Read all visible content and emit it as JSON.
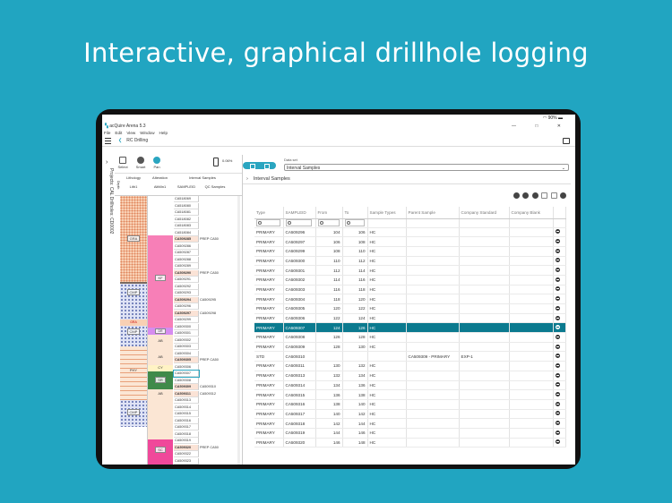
{
  "headline": "Interactive, graphical drillhole logging",
  "status": {
    "battery": "90%"
  },
  "window": {
    "title": "acQuire Arena 5.3",
    "controls": "— □ ✕"
  },
  "menu": [
    "File",
    "Edit",
    "View",
    "Window",
    "Help"
  ],
  "breadcrumb": {
    "back": "❮",
    "title": "RC Drilling"
  },
  "side_path": "Projects: CAL   Drillholes: CD0002",
  "left_toolbar": {
    "tools": [
      "Select",
      "Smart",
      "Pan"
    ],
    "zoom": "0.06%"
  },
  "log_headers": {
    "lithology": "Lithology",
    "alteration": "Alteration",
    "interval_samples": "Interval Samples",
    "depth": "Depth",
    "lith": "Lith1",
    "altmin": "AltMin1",
    "sampleid": "SAMPLEID",
    "qc": "QC Samples"
  },
  "lith_labels": {
    "gra": "GRA",
    "cmp1": "CMP",
    "gra2": "GRA",
    "cmp2": "CMP",
    "phy": "PHY",
    "cmp3": "CMP"
  },
  "alt_labels": {
    "kf": "KF",
    "dr": "DR",
    "ab1": "AB",
    "ab2": "AB",
    "cy": "CY",
    "sr": "SR",
    "ab3": "AB",
    "sc": "SC"
  },
  "log_samples": [
    {
      "id": "CA518069",
      "qc": "",
      "hl": false
    },
    {
      "id": "CA518080",
      "qc": "",
      "hl": false
    },
    {
      "id": "CA518081",
      "qc": "",
      "hl": false
    },
    {
      "id": "CA518082",
      "qc": "",
      "hl": false
    },
    {
      "id": "CA518083",
      "qc": "",
      "hl": false
    },
    {
      "id": "CA518084",
      "qc": "",
      "hl": false
    },
    {
      "id": "CA509285",
      "qc": "PREP CA50",
      "hl": true
    },
    {
      "id": "CA509286",
      "qc": "",
      "hl": false
    },
    {
      "id": "CA509287",
      "qc": "",
      "hl": false
    },
    {
      "id": "CA509288",
      "qc": "",
      "hl": false
    },
    {
      "id": "CA509289",
      "qc": "",
      "hl": false
    },
    {
      "id": "CA509290",
      "qc": "PREP CA50",
      "hl": true
    },
    {
      "id": "CA509291",
      "qc": "",
      "hl": false
    },
    {
      "id": "CA509292",
      "qc": "",
      "hl": false
    },
    {
      "id": "CA509293",
      "qc": "",
      "hl": false
    },
    {
      "id": "CA509294",
      "qc": "CA509295",
      "hl": true
    },
    {
      "id": "CA509296",
      "qc": "",
      "hl": false
    },
    {
      "id": "CA509297",
      "qc": "CA509298",
      "hl": true
    },
    {
      "id": "CA509299",
      "qc": "",
      "hl": false
    },
    {
      "id": "CA509300",
      "qc": "",
      "hl": false
    },
    {
      "id": "CA509301",
      "qc": "",
      "hl": false
    },
    {
      "id": "CA509302",
      "qc": "",
      "hl": false
    },
    {
      "id": "CA509303",
      "qc": "",
      "hl": false
    },
    {
      "id": "CA509304",
      "qc": "",
      "hl": false
    },
    {
      "id": "CA509305",
      "qc": "PREP CA50",
      "hl": true
    },
    {
      "id": "CA509306",
      "qc": "",
      "hl": false
    },
    {
      "id": "CA509307",
      "qc": "",
      "hl": false,
      "sel": true
    },
    {
      "id": "CA509308",
      "qc": "",
      "hl": false
    },
    {
      "id": "CA509309",
      "qc": "CA509310",
      "hl": true
    },
    {
      "id": "CA509311",
      "qc": "CA509312",
      "hl": true
    },
    {
      "id": "CA509313",
      "qc": "",
      "hl": false
    },
    {
      "id": "CA509314",
      "qc": "",
      "hl": false
    },
    {
      "id": "CA509315",
      "qc": "",
      "hl": false
    },
    {
      "id": "CA509316",
      "qc": "",
      "hl": false
    },
    {
      "id": "CA509317",
      "qc": "",
      "hl": false
    },
    {
      "id": "CA509318",
      "qc": "",
      "hl": false
    },
    {
      "id": "CA509319",
      "qc": "",
      "hl": false
    },
    {
      "id": "CA509320",
      "qc": "PREP CA50",
      "hl": true
    },
    {
      "id": "CA509322",
      "qc": "",
      "hl": false
    },
    {
      "id": "CA509323",
      "qc": "",
      "hl": false
    }
  ],
  "dataset": {
    "label": "Data set",
    "value": "Interval Samples"
  },
  "section_title": "Interval Samples",
  "grid": {
    "columns": [
      "Type",
      "SAMPLEID",
      "From",
      "To",
      "Sample Types",
      "Parent Sample",
      "Company Standard",
      "Company Blank"
    ],
    "rows": [
      [
        "PRIMARY",
        "CA509296",
        "104",
        "106",
        "HC",
        "",
        "",
        ""
      ],
      [
        "PRIMARY",
        "CA509297",
        "106",
        "108",
        "HC",
        "",
        "",
        ""
      ],
      [
        "PRIMARY",
        "CA509299",
        "108",
        "110",
        "HC",
        "",
        "",
        ""
      ],
      [
        "PRIMARY",
        "CA509300",
        "110",
        "112",
        "HC",
        "",
        "",
        ""
      ],
      [
        "PRIMARY",
        "CA509301",
        "112",
        "114",
        "HC",
        "",
        "",
        ""
      ],
      [
        "PRIMARY",
        "CA509302",
        "114",
        "116",
        "HC",
        "",
        "",
        ""
      ],
      [
        "PRIMARY",
        "CA509303",
        "116",
        "118",
        "HC",
        "",
        "",
        ""
      ],
      [
        "PRIMARY",
        "CA509304",
        "118",
        "120",
        "HC",
        "",
        "",
        ""
      ],
      [
        "PRIMARY",
        "CA509305",
        "120",
        "122",
        "HC",
        "",
        "",
        ""
      ],
      [
        "PRIMARY",
        "CA509306",
        "122",
        "124",
        "HC",
        "",
        "",
        ""
      ],
      [
        "PRIMARY",
        "CA509307",
        "124",
        "126",
        "HC",
        "",
        "",
        ""
      ],
      [
        "PRIMARY",
        "CA509308",
        "126",
        "128",
        "HC",
        "",
        "",
        ""
      ],
      [
        "PRIMARY",
        "CA509309",
        "128",
        "130",
        "HC",
        "",
        "",
        ""
      ],
      [
        "STD",
        "CA509310",
        "",
        "",
        "",
        "CA509309 - PRIMARY",
        "EXP-1",
        ""
      ],
      [
        "PRIMARY",
        "CA509311",
        "130",
        "132",
        "HC",
        "",
        "",
        ""
      ],
      [
        "PRIMARY",
        "CA509313",
        "132",
        "134",
        "HC",
        "",
        "",
        ""
      ],
      [
        "PRIMARY",
        "CA509314",
        "134",
        "136",
        "HC",
        "",
        "",
        ""
      ],
      [
        "PRIMARY",
        "CA509315",
        "136",
        "138",
        "HC",
        "",
        "",
        ""
      ],
      [
        "PRIMARY",
        "CA509316",
        "138",
        "140",
        "HC",
        "",
        "",
        ""
      ],
      [
        "PRIMARY",
        "CA509317",
        "140",
        "142",
        "HC",
        "",
        "",
        ""
      ],
      [
        "PRIMARY",
        "CA509318",
        "142",
        "144",
        "HC",
        "",
        "",
        ""
      ],
      [
        "PRIMARY",
        "CA509319",
        "144",
        "146",
        "HC",
        "",
        "",
        ""
      ],
      [
        "PRIMARY",
        "CA509320",
        "146",
        "148",
        "HC",
        "",
        "",
        ""
      ]
    ],
    "selected_row": 10
  },
  "colors": {
    "accent": "#2aa5c0",
    "selected_row": "#0b7a8f",
    "background": "#21a5c1",
    "kf": "#f77fb7",
    "sc": "#f0489a",
    "sr": "#3f8a4a",
    "dr": "#d68cf0"
  }
}
